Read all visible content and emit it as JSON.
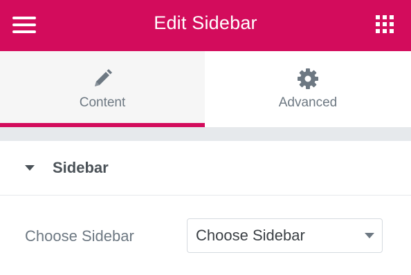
{
  "header": {
    "title": "Edit Sidebar",
    "menu_icon": "hamburger-icon",
    "widgets_icon": "grid-icon",
    "background_color": "#d30c5c"
  },
  "tabs": [
    {
      "label": "Content",
      "icon": "pencil-icon",
      "active": true
    },
    {
      "label": "Advanced",
      "icon": "gear-icon",
      "active": false
    }
  ],
  "section": {
    "title": "Sidebar",
    "toggle_icon": "caret-down-icon",
    "expanded": true
  },
  "control": {
    "label": "Choose Sidebar",
    "selected_value": "Choose Sidebar",
    "dropdown_icon": "chevron-down-icon"
  },
  "colors": {
    "accent": "#d30c5c",
    "text_muted": "#6d7882",
    "text_dark": "#4a5157",
    "separator": "#e6e9ec"
  }
}
